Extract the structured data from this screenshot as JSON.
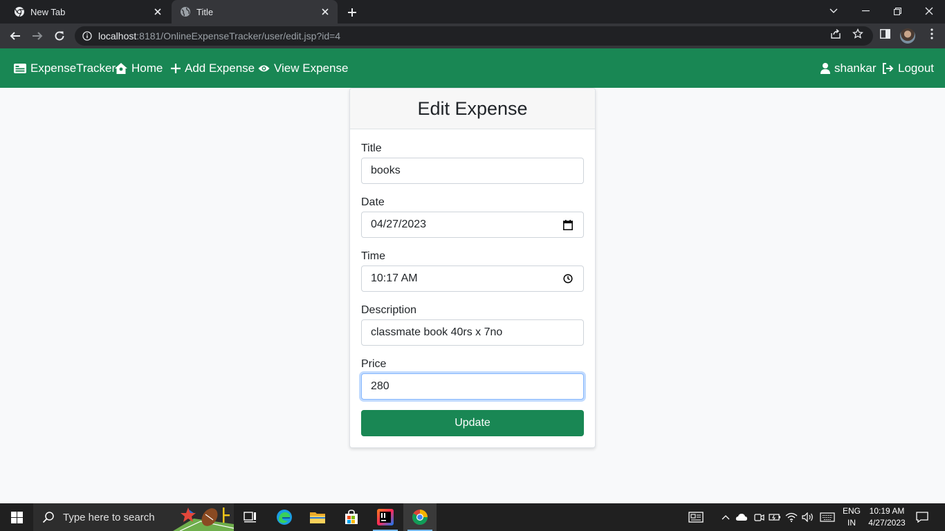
{
  "browser": {
    "tabs": [
      {
        "title": "New Tab",
        "active": false
      },
      {
        "title": "Title",
        "active": true
      }
    ],
    "url_host": "localhost",
    "url_rest": ":8181/OnlineExpenseTracker/user/edit.jsp?id=4"
  },
  "navbar": {
    "brand": "ExpenseTracker",
    "links": [
      "Home",
      "Add Expense",
      "View Expense"
    ],
    "user": "shankar",
    "logout": "Logout"
  },
  "form": {
    "heading": "Edit Expense",
    "fields": [
      {
        "label": "Title",
        "value": "books",
        "type": "text"
      },
      {
        "label": "Date",
        "value": "04/27/2023",
        "type": "date"
      },
      {
        "label": "Time",
        "value": "10:17 AM",
        "type": "time"
      },
      {
        "label": "Description",
        "value": "classmate book 40rs x 7no",
        "type": "text"
      },
      {
        "label": "Price",
        "value": "280",
        "type": "number",
        "focused": true
      }
    ],
    "submit": "Update"
  },
  "taskbar": {
    "search_placeholder": "Type here to search",
    "language": "ENG",
    "region": "IN",
    "time": "10:19 AM",
    "date": "4/27/2023"
  },
  "colors": {
    "brand_green": "#198754",
    "chrome_dark": "#202124",
    "chrome_toolbar": "#35363a",
    "focus_border": "#86b7fe"
  }
}
